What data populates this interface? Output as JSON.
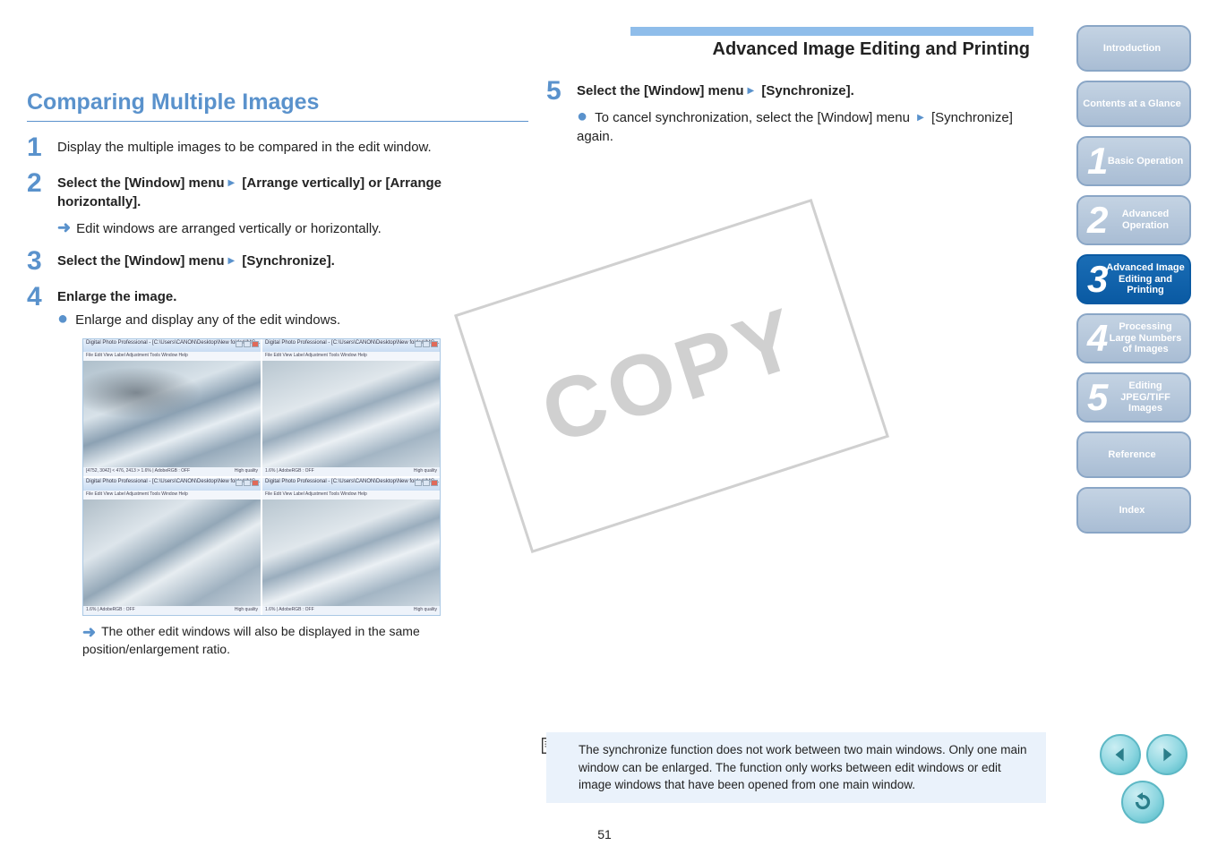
{
  "watermark": "COPY",
  "left": {
    "title": "Comparing Multiple Images",
    "step1": "Display the multiple images to be compared in the edit window.",
    "step2_pre": "Select the [Window] menu",
    "step2_post": " [Arrange vertically] or [Arrange horizontally].",
    "step2_result": "Edit windows are arranged vertically or horizontally.",
    "step3_pre": "Select the [Window] menu",
    "step3_post": " [Synchronize].",
    "step4": "Enlarge the image.",
    "step4_sub": "Enlarge and display any of the edit windows.",
    "step4_caption": "The other edit windows will also be displayed in the same position/enlargement ratio.",
    "pane_title": "Digital Photo Professional - [C:\\Users\\CANON\\Desktop\\New folder\\IMG_...]",
    "pane_menu": "File  Edit  View  Label  Adjustment  Tools  Window  Help",
    "pane_status_left": "1.6% | AdobeRGB : OFF",
    "pane_status_left_tl": "[4752, 3042] < 476, 2413 >    1.6% | AdobeRGB : OFF",
    "pane_status_right": "High quality"
  },
  "right": {
    "header": "Advanced Image Editing and Printing",
    "step5_pre": "Select the [Window] menu",
    "step5_post": " [Synchronize].",
    "step5_bullet_pre": "To cancel synchronization, select the [Window] menu",
    "step5_bullet_post": " [Synchronize] again."
  },
  "sidebar": [
    {
      "label": "Introduction"
    },
    {
      "label": "Contents at a Glance"
    },
    {
      "num": "1",
      "label": "Basic Operation"
    },
    {
      "num": "2",
      "label": "Advanced Operation"
    },
    {
      "num": "3",
      "label": "Advanced Image Editing and Printing",
      "active": true
    },
    {
      "num": "4",
      "label": "Processing Large Numbers of Images"
    },
    {
      "num": "5",
      "label": "Editing JPEG/TIFF Images"
    },
    {
      "label": "Reference"
    },
    {
      "label": "Index"
    }
  ],
  "note": "The synchronize function does not work between two main windows. Only one main window can be enlarged. The function only works between edit windows or edit image windows that have been opened from one main window.",
  "page_number": "51"
}
